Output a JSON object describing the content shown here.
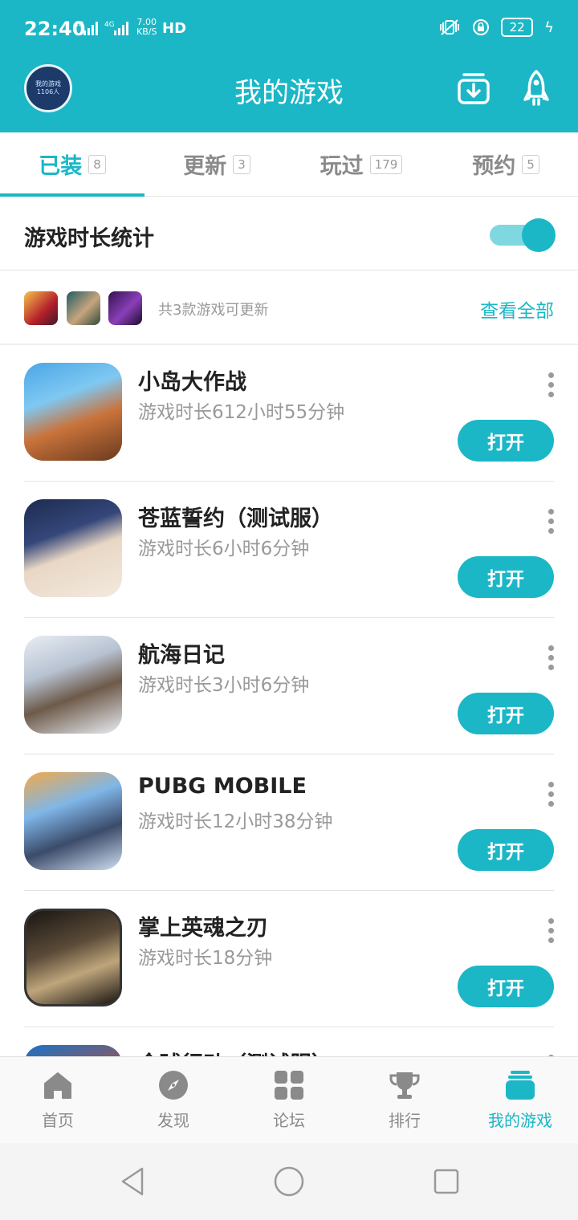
{
  "status_bar": {
    "time": "22:40",
    "network": "4G 4G",
    "speed_value": "7.00",
    "speed_unit": "KB/S",
    "hd": "HD",
    "battery": "22"
  },
  "header": {
    "title": "我的游戏",
    "avatar_text_line1": "我的游戏",
    "avatar_text_line2": "1106人"
  },
  "tabs": [
    {
      "label": "已装",
      "count": "8",
      "active": true
    },
    {
      "label": "更新",
      "count": "3",
      "active": false
    },
    {
      "label": "玩过",
      "count": "179",
      "active": false
    },
    {
      "label": "预约",
      "count": "5",
      "active": false
    }
  ],
  "stats_toggle": {
    "label": "游戏时长统计",
    "enabled": true
  },
  "updates": {
    "text": "共3款游戏可更新",
    "view_all": "查看全部"
  },
  "games": [
    {
      "name": "小岛大作战",
      "duration": "游戏时长612小时55分钟",
      "button": "打开"
    },
    {
      "name": "苍蓝誓约（测试服）",
      "duration": "游戏时长6小时6分钟",
      "button": "打开"
    },
    {
      "name": "航海日记",
      "duration": "游戏时长3小时6分钟",
      "button": "打开"
    },
    {
      "name": "PUBG MOBILE",
      "duration": "游戏时长12小时38分钟",
      "button": "打开"
    },
    {
      "name": "掌上英魂之刃",
      "duration": "游戏时长18分钟",
      "button": "打开"
    },
    {
      "name": "全球行动（测试服）",
      "duration": "",
      "button": ""
    }
  ],
  "bottom_nav": [
    {
      "label": "首页",
      "icon": "home-icon"
    },
    {
      "label": "发现",
      "icon": "compass-icon"
    },
    {
      "label": "论坛",
      "icon": "grid-icon"
    },
    {
      "label": "排行",
      "icon": "trophy-icon"
    },
    {
      "label": "我的游戏",
      "icon": "game-stack-icon",
      "active": true
    }
  ],
  "colors": {
    "accent": "#1bb7c6",
    "text_secondary": "#999999"
  }
}
